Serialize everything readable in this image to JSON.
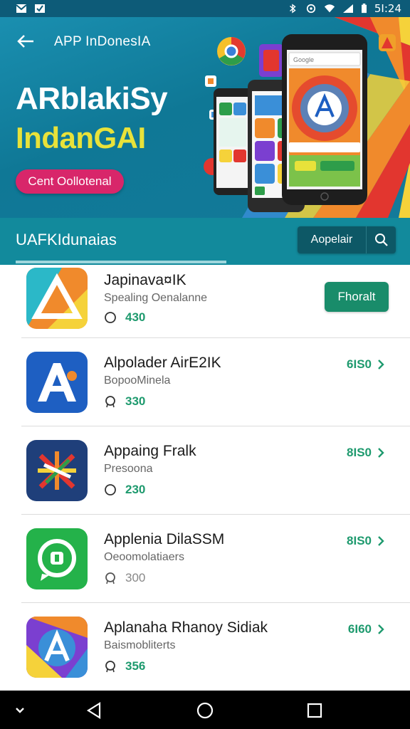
{
  "status_bar": {
    "time": "5I:24",
    "icons": [
      "mail-icon",
      "mail-check-icon",
      "bluetooth-icon",
      "location-icon",
      "wifi-icon",
      "signal-icon",
      "battery-icon"
    ]
  },
  "header": {
    "title": "APP InDonesIA",
    "back_icon": "back-arrow-icon"
  },
  "hero": {
    "headline_line1": "ARblakiSy",
    "headline_line2": "IndanGAI",
    "cta_label": "Cent Oollotenal",
    "phone_search_placeholder": "Google",
    "accent_colors": {
      "headline_yellow": "#e8e23a",
      "cta_pink": "#d8266a"
    }
  },
  "tab_bar": {
    "label": "UAFKIdunaias",
    "search_button_label": "Aopelair",
    "search_icon": "search-icon"
  },
  "apps": [
    {
      "name": "Japinava¤IK",
      "developer": "Spealing Oenalanne",
      "rating": "430",
      "rating_icon": "circle-icon",
      "action": "install",
      "action_label": "Fhoralt"
    },
    {
      "name": "Alpolader AirE2IK",
      "developer": "BopooMinela",
      "rating": "330",
      "rating_icon": "badge-icon",
      "action": "price",
      "price": "6IS0"
    },
    {
      "name": "Appaing Fralk",
      "developer": "Presoona",
      "rating": "230",
      "rating_icon": "circle-icon",
      "action": "price",
      "price": "8IS0"
    },
    {
      "name": "Applenia DilaSSM",
      "developer": "Oeoomolatiaers",
      "rating": "300",
      "rating_icon": "badge-icon",
      "action": "price",
      "price": "8IS0"
    },
    {
      "name": "Aplanaha Rhanoy Sidiak",
      "developer": "Baismobliterts",
      "rating": "356",
      "rating_icon": "badge-icon",
      "action": "price",
      "price": "6I60"
    }
  ],
  "colors": {
    "teal_dark": "#0d5866",
    "teal_bar": "#128a9c",
    "green_accent": "#1e9a6e"
  },
  "nav_bar": {
    "icons": [
      "collapse-chevron-icon",
      "back-triangle-icon",
      "home-circle-icon",
      "recents-square-icon"
    ]
  }
}
